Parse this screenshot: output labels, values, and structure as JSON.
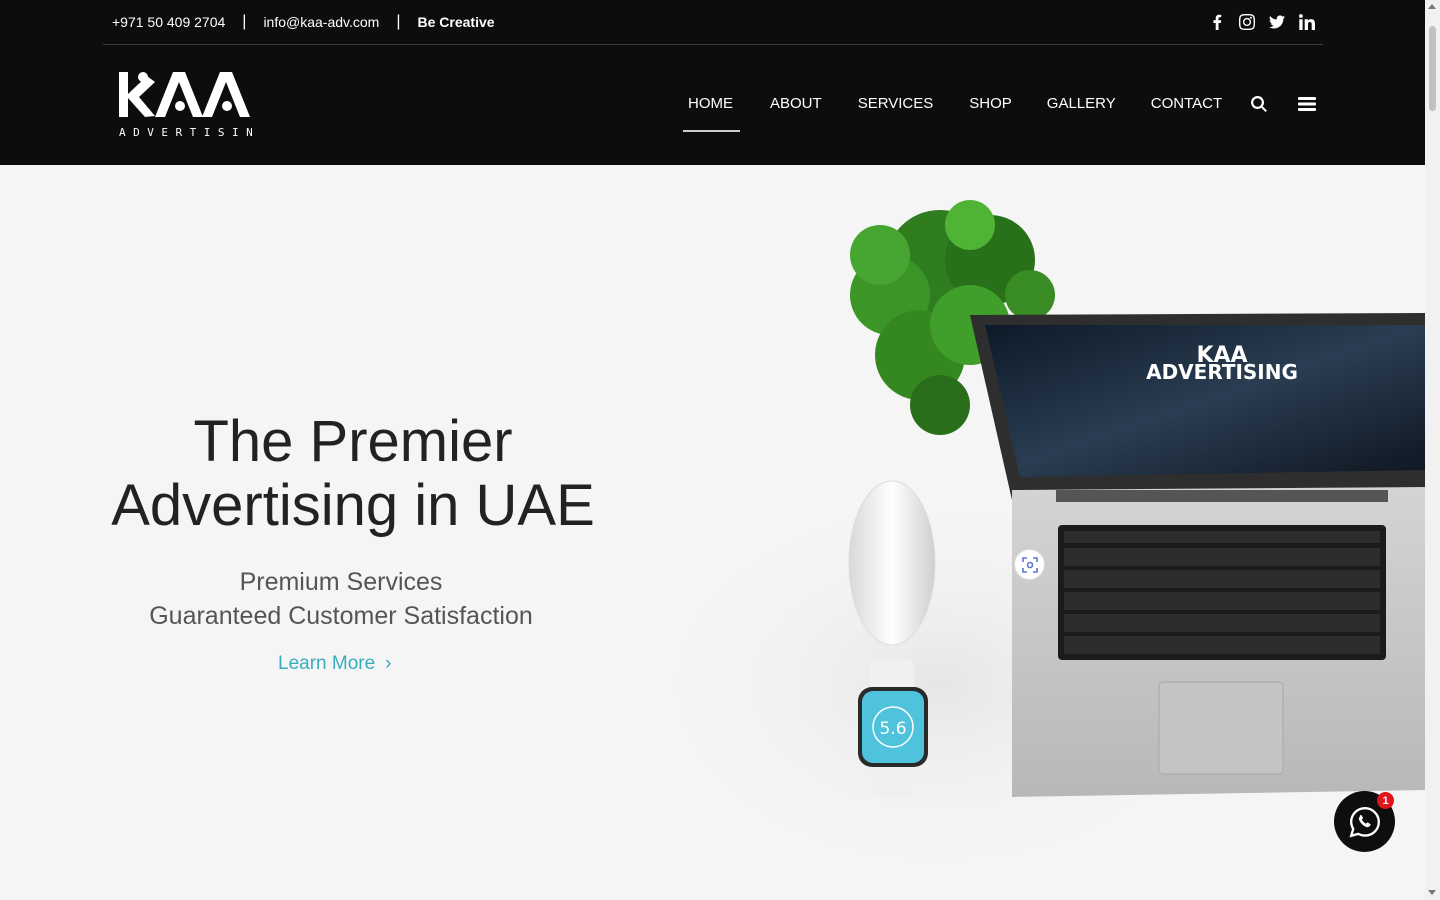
{
  "topbar": {
    "phone": "+971 50 409 2704",
    "email": "info@kaa-adv.com",
    "tagline": "Be Creative",
    "separator": "|",
    "socials": [
      "facebook-icon",
      "instagram-icon",
      "twitter-icon",
      "linkedin-icon"
    ]
  },
  "logo": {
    "main": "KAA",
    "sub": "ADVERTISING"
  },
  "nav": {
    "items": [
      {
        "label": "HOME",
        "active": true
      },
      {
        "label": "ABOUT",
        "active": false
      },
      {
        "label": "SERVICES",
        "active": false
      },
      {
        "label": "SHOP",
        "active": false
      },
      {
        "label": "GALLERY",
        "active": false
      },
      {
        "label": "CONTACT",
        "active": false
      }
    ],
    "icons": [
      "search-icon",
      "hamburger-menu-icon"
    ]
  },
  "hero": {
    "title_line1": "The Premier",
    "title_line2": "Advertising in UAE",
    "sub_line1": "Premium Services",
    "sub_line2": "Guaranteed Customer Satisfaction",
    "cta": "Learn More",
    "cta_chevron": "›",
    "screen_title_1": "KAA",
    "screen_title_2": "ADVERTISING",
    "watch_value": "5.6"
  },
  "whatsapp": {
    "badge": "1"
  },
  "colors": {
    "header_bg": "#0d0d0d",
    "hero_bg": "#f5f5f5",
    "accent": "#36aebd",
    "badge": "#e1161c"
  }
}
